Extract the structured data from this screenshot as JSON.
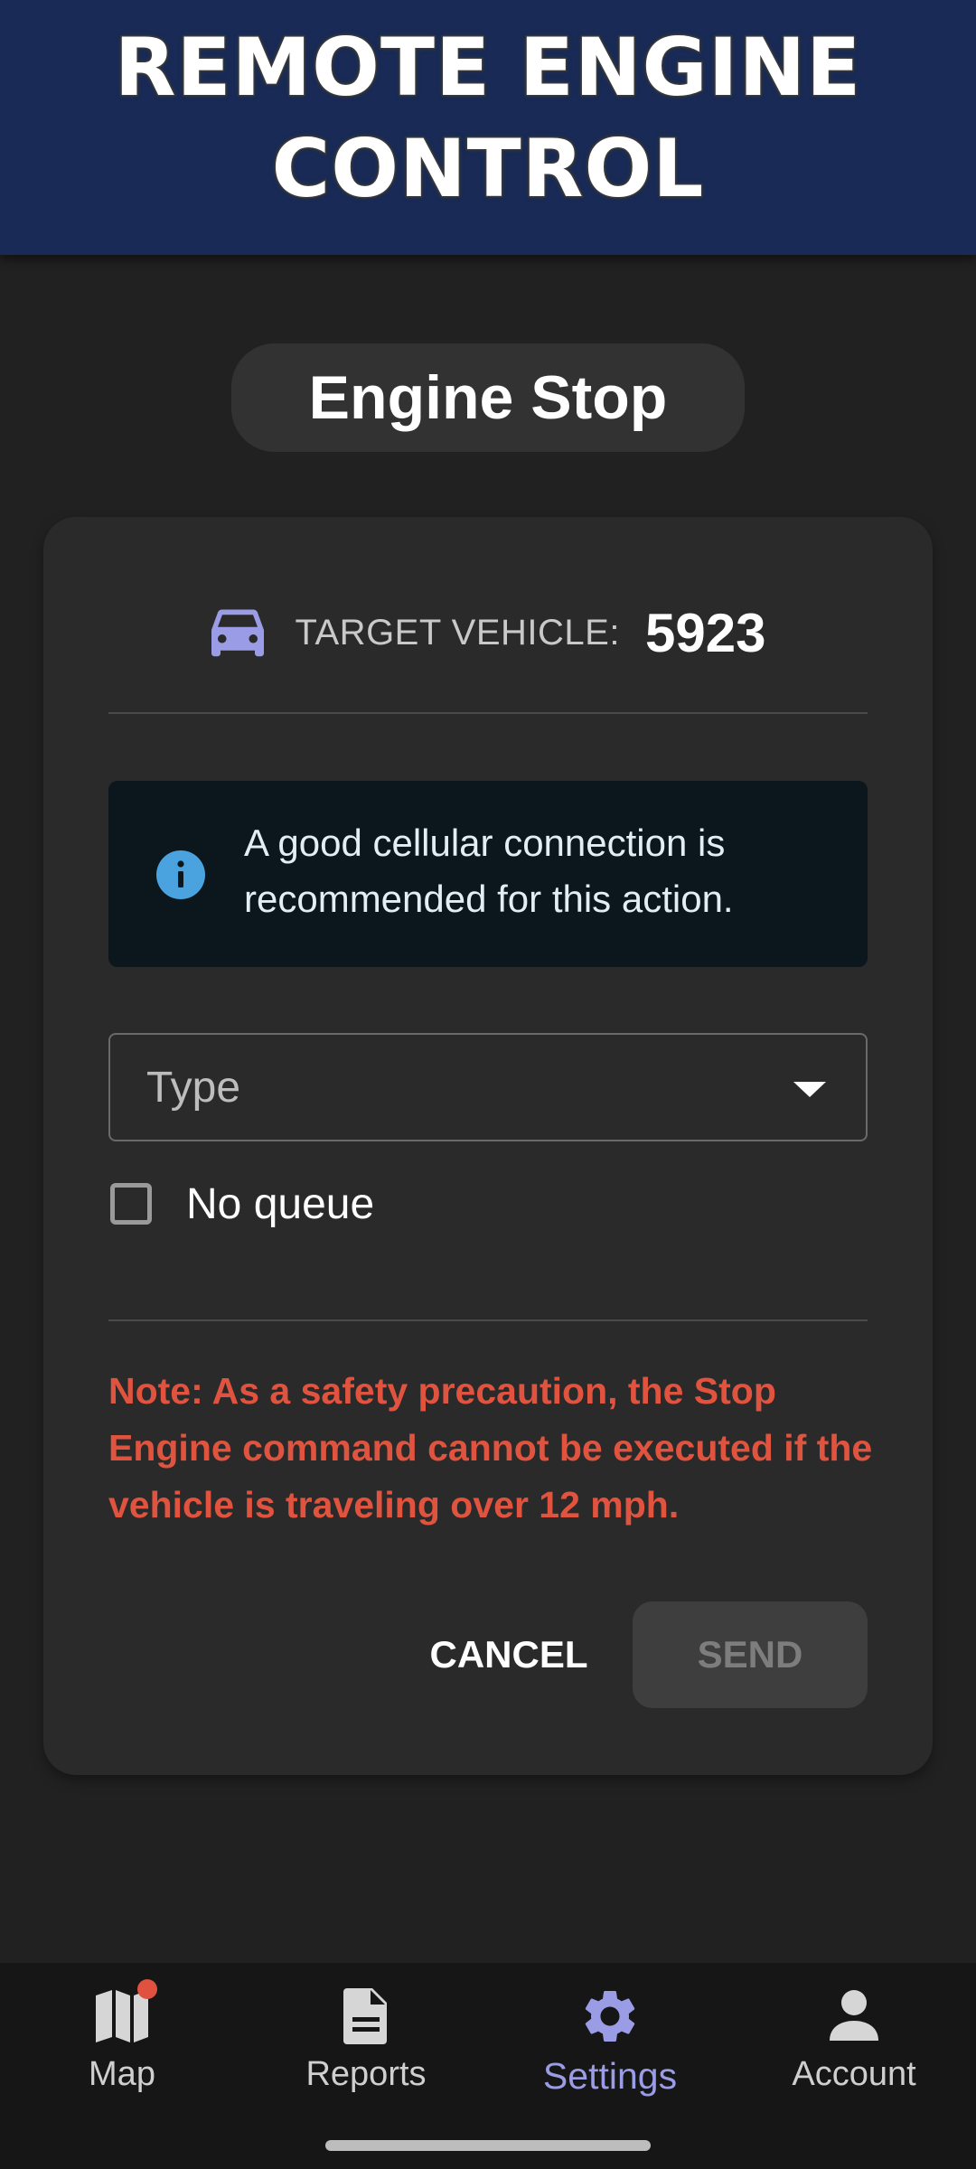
{
  "banner": {
    "title": "REMOTE ENGINE CONTROL"
  },
  "header": {
    "title": "Engine Stop"
  },
  "vehicle": {
    "icon": "car-icon",
    "label": "TARGET VEHICLE:",
    "value": "5923"
  },
  "info": {
    "icon": "info-icon",
    "text": "A good cellular connection is recommended for this action."
  },
  "type_select": {
    "placeholder": "Type",
    "icon": "chevron-down-icon"
  },
  "no_queue": {
    "label": "No queue",
    "checked": false
  },
  "note": "Note: As a safety precaution, the Stop Engine command cannot be executed if the vehicle is traveling over 12 mph.",
  "actions": {
    "cancel_label": "CANCEL",
    "send_label": "SEND"
  },
  "bottom_nav": {
    "items": [
      {
        "label": "Map",
        "icon": "map-icon",
        "has_badge": true
      },
      {
        "label": "Reports",
        "icon": "document-icon"
      },
      {
        "label": "Settings",
        "icon": "gear-icon",
        "active": true
      },
      {
        "label": "Account",
        "icon": "person-icon"
      }
    ]
  },
  "colors": {
    "banner_bg": "#182a55",
    "page_bg": "#212121",
    "card_bg": "#2a2a2a",
    "note_red": "#e0543f",
    "active_accent": "#9a9ce6",
    "info_bg": "#0c161d",
    "info_icon_blue": "#4aa3df"
  }
}
